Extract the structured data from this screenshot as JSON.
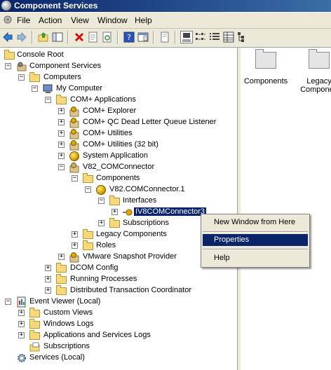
{
  "window": {
    "title": "Component Services"
  },
  "menu": {
    "items": [
      "File",
      "Action",
      "View",
      "Window",
      "Help"
    ]
  },
  "toolbar": {
    "buttons": [
      "back-icon",
      "forward-icon",
      "up-folder-icon",
      "show-tree-icon",
      "delete-icon",
      "properties-icon",
      "refresh-icon",
      "help-icon",
      "console-icon",
      "export-icon",
      "large-icons-icon",
      "small-icons-icon",
      "list-icon",
      "details-icon",
      "tree-icon"
    ]
  },
  "tree": {
    "console_root": "Console Root",
    "component_services": "Component Services",
    "computers": "Computers",
    "my_computer": "My Computer",
    "com_apps": "COM+ Applications",
    "com_explorer": "COM+ Explorer",
    "com_qc": "COM+ QC Dead Letter Queue Listener",
    "com_utilities": "COM+ Utilities",
    "com_utilities32": "COM+ Utilities (32 bit)",
    "system_app": "System Application",
    "v82_comconnector": "V82_COMConnector",
    "components": "Components",
    "v82_comconnector1": "V82.COMConnector.1",
    "interfaces": "Interfaces",
    "iv8comconnector3": "IV8COMConnector3",
    "subscriptions": "Subscriptions",
    "legacy_components": "Legacy Components",
    "roles": "Roles",
    "vmware": "VMware Snapshot Provider",
    "dcom_config": "DCOM Config",
    "running_processes": "Running Processes",
    "dtc": "Distributed Transaction Coordinator",
    "event_viewer": "Event Viewer (Local)",
    "custom_views": "Custom Views",
    "windows_logs": "Windows Logs",
    "app_services_logs": "Applications and Services Logs",
    "subscriptions2": "Subscriptions",
    "services": "Services (Local)"
  },
  "context_menu": {
    "new_window": "New Window from Here",
    "properties": "Properties",
    "help": "Help"
  },
  "right_pane": {
    "components": "Components",
    "legacy_line1": "Legacy",
    "legacy_line2": "Componen"
  }
}
